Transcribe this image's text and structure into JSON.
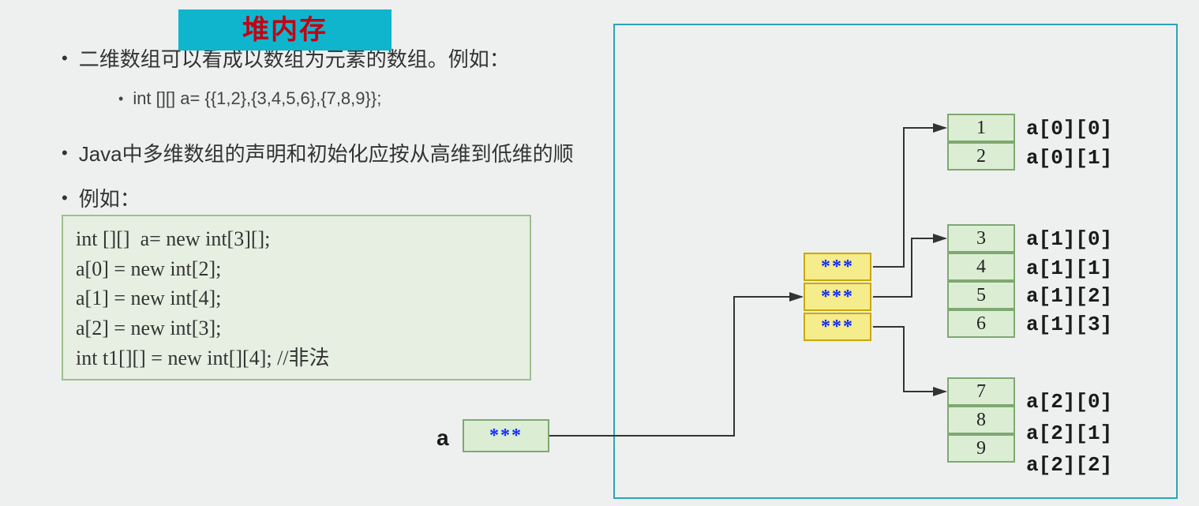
{
  "bullets": {
    "b1": "二维数组可以看成以数组为元素的数组。例如：",
    "b1_sub": "int [][] a= {{1,2},{3,4,5,6},{7,8,9}};",
    "b2": "Java中多维数组的声明和初始化应按从高维到低维的顺",
    "b3": "例如："
  },
  "code": "int [][]  a= new int[3][];\na[0] = new int[2];\na[1] = new int[4];\na[2] = new int[3];\nint t1[][] = new int[][4]; //非法",
  "heap": {
    "title": "堆内存",
    "a_var": "a",
    "ref": "***",
    "group0": {
      "vals": [
        "1",
        "2"
      ],
      "labels": [
        "a[0][0]",
        "a[0][1]"
      ]
    },
    "group1": {
      "vals": [
        "3",
        "4",
        "5",
        "6"
      ],
      "labels": [
        "a[1][0]",
        "a[1][1]",
        "a[1][2]",
        "a[1][3]"
      ]
    },
    "group2": {
      "vals": [
        "7",
        "8",
        "9"
      ],
      "labels": [
        "a[2][0]",
        "a[2][1]",
        "a[2][2]"
      ]
    }
  }
}
